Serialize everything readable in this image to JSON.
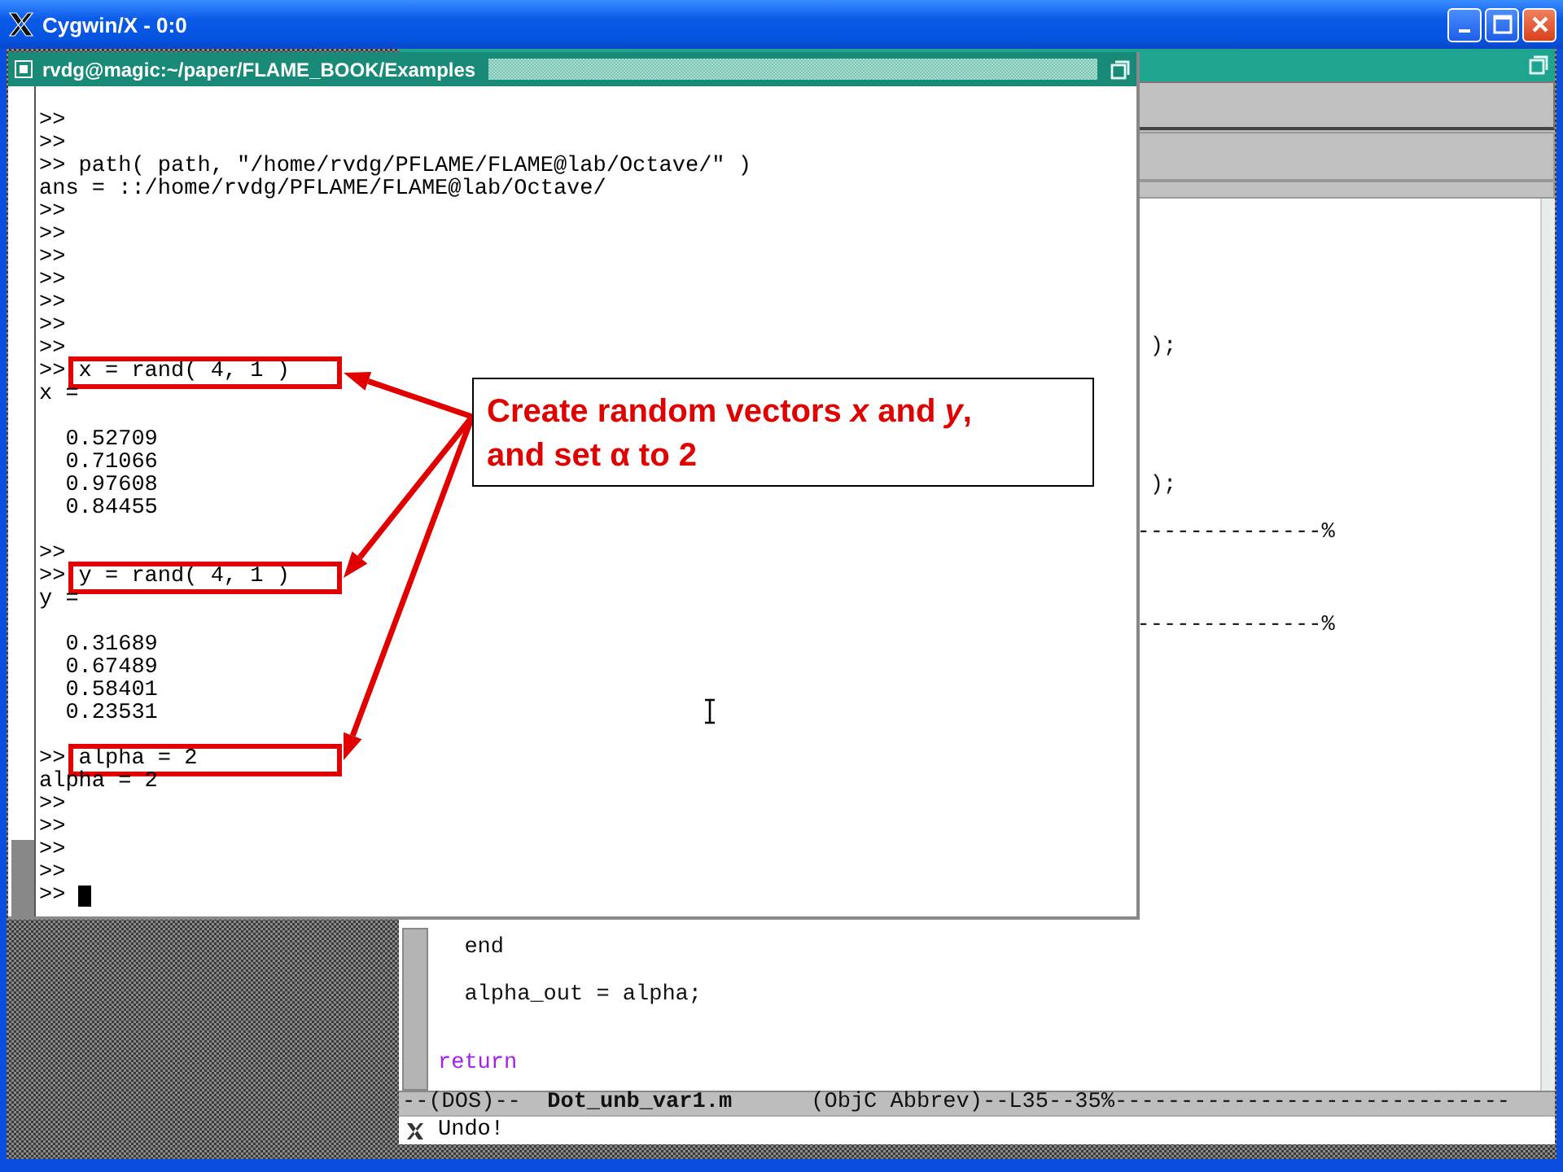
{
  "window": {
    "title": "Cygwin/X - 0:0"
  },
  "terminal": {
    "title": "rvdg@magic:~/paper/FLAME_BOOK/Examples",
    "lines": [
      {
        "text": ">>"
      },
      {
        "text": ">>"
      },
      {
        "text": ">> path( path, \"/home/rvdg/PFLAME/FLAME@lab/Octave/\" )"
      },
      {
        "text": "ans = ::/home/rvdg/PFLAME/FLAME@lab/Octave/"
      },
      {
        "text": ">>"
      },
      {
        "text": ">>"
      },
      {
        "text": ">>"
      },
      {
        "text": ">>"
      },
      {
        "text": ">>"
      },
      {
        "text": ">>"
      },
      {
        "text": ">>"
      },
      {
        "text": ">> x = rand( 4, 1 )",
        "highlighted": true
      },
      {
        "text": "x ="
      },
      {
        "text": "  0.52709",
        "blank_before": true
      },
      {
        "text": "  0.71066"
      },
      {
        "text": "  0.97608"
      },
      {
        "text": "  0.84455"
      },
      {
        "text": ">>",
        "blank_before": true
      },
      {
        "text": ">> y = rand( 4, 1 )",
        "highlighted": true
      },
      {
        "text": "y ="
      },
      {
        "text": "  0.31689",
        "blank_before": true
      },
      {
        "text": "  0.67489"
      },
      {
        "text": "  0.58401"
      },
      {
        "text": "  0.23531"
      },
      {
        "text": ">> alpha = 2",
        "blank_before": true,
        "highlighted": true
      },
      {
        "text": "alpha = 2"
      },
      {
        "text": ">>"
      },
      {
        "text": ">>"
      },
      {
        "text": ">>"
      },
      {
        "text": ">>"
      },
      {
        "text": ">>",
        "cursor": true
      }
    ]
  },
  "editor": {
    "lines": [
      {
        "text": ");",
        "kind": "code"
      },
      {
        "text": ");",
        "kind": "code"
      },
      {
        "text": "--------------%",
        "kind": "code"
      },
      {
        "text": "--------------%",
        "kind": "code"
      },
      {
        "text": "end",
        "kind": "code"
      },
      {
        "text": "alpha_out = alpha;",
        "kind": "code"
      },
      {
        "text": "return",
        "kind": "keyword"
      }
    ],
    "mode_line": "--(DOS)--  **Dot_unb_var1.m**      (ObjC Abbrev)--L35--35%------------------------------",
    "minibuffer": "Undo!"
  },
  "callout": {
    "lines": [
      "Create random vectors *x* and *y*,",
      "and set α to 2"
    ]
  }
}
